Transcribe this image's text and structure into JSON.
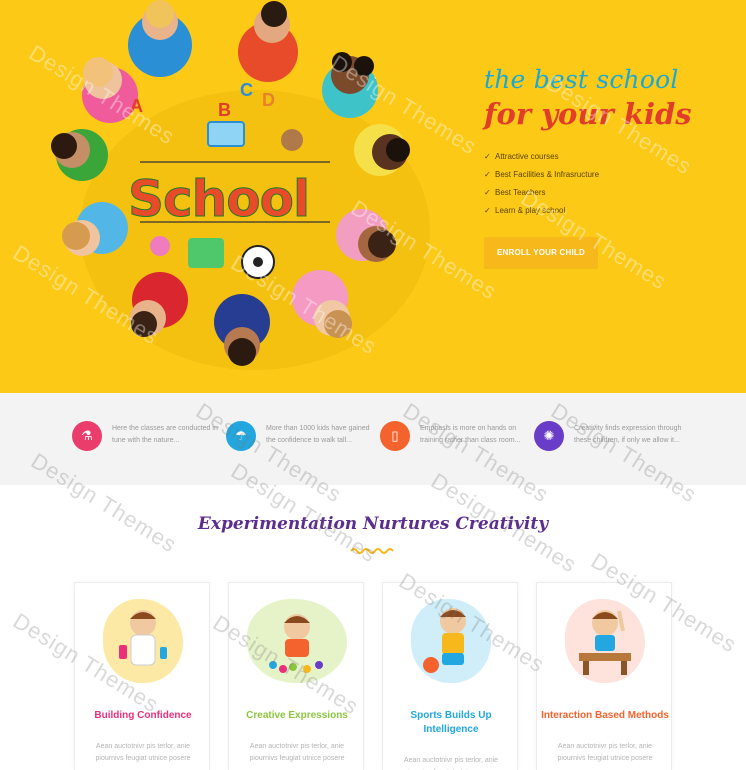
{
  "hero": {
    "tagline": "the best school",
    "title": "for your kids",
    "features": [
      "Attractive courses",
      "Best Facilities & Infrasructure",
      "Best Teachers",
      "Learn & play school"
    ],
    "cta_label": "ENROLL YOUR CHILD",
    "art_word": "School",
    "art_letters": [
      "A",
      "B",
      "C",
      "D"
    ],
    "colors": {
      "background": "#fcc917",
      "tagline": "#1aa9d6",
      "title": "#e23c2a",
      "button": "#f6b81a"
    }
  },
  "strip": {
    "items": [
      {
        "icon": "flask-icon",
        "color": "#ea3d6b",
        "text": "Here the classes are conducted in tune with the nature..."
      },
      {
        "icon": "umbrella-icon",
        "color": "#22a7e0",
        "text": "More than 1000 kids have gained the confidence to walk tall..."
      },
      {
        "icon": "jar-icon",
        "color": "#f4632d",
        "text": "Emphasis is more on hands on training rather than class room..."
      },
      {
        "icon": "bulb-icon",
        "color": "#6a3dc8",
        "text": "Creativity finds expression through these children, if only we allow it..."
      }
    ]
  },
  "section": {
    "title": "Experimentation Nurtures Creativity",
    "cards": [
      {
        "title": "Building Confidence",
        "color": "#ec2f7a",
        "blob": "#fde9a6",
        "body": "Aean auctotnivr pis terlor, anie piournivs feugiat utnice posere"
      },
      {
        "title": "Creative Expressions",
        "color": "#8cc63f",
        "blob": "#e6f3c9",
        "body": "Aean auctotnivr pis terlor, anie piournivs feugiat utnice posere"
      },
      {
        "title": "Sports Builds Up Intelligence",
        "color": "#22a7e0",
        "blob": "#cfeefa",
        "body": "Aean auctotnivr pis terlor, anie piournivs feugiat utnice posere"
      },
      {
        "title": "Interaction Based Methods",
        "color": "#f4632d",
        "blob": "#fde3dc",
        "body": "Aean auctotnivr pis terlor, anie piournivs feugiat utnice posere"
      }
    ]
  },
  "watermark": "Design Themes"
}
